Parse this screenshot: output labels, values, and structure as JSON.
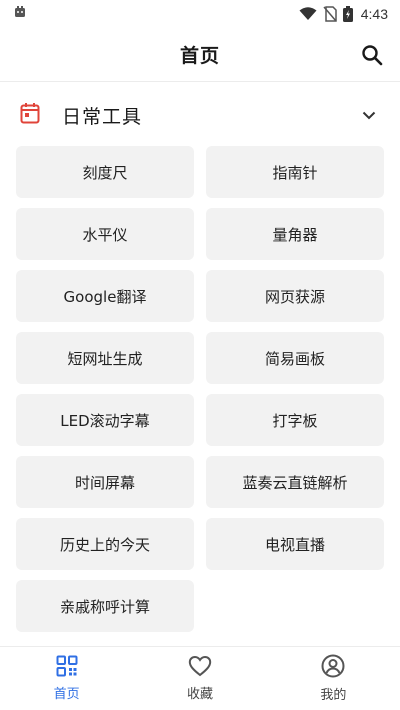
{
  "status_bar": {
    "time": "4:43"
  },
  "header": {
    "title": "首页"
  },
  "section": {
    "title": "日常工具"
  },
  "tools": [
    "刻度尺",
    "指南针",
    "水平仪",
    "量角器",
    "Google翻译",
    "网页获源",
    "短网址生成",
    "简易画板",
    "LED滚动字幕",
    "打字板",
    "时间屏幕",
    "蓝奏云直链解析",
    "历史上的今天",
    "电视直播",
    "亲戚称呼计算"
  ],
  "bottom_nav": [
    {
      "label": "首页",
      "icon": "grid-icon",
      "active": true
    },
    {
      "label": "收藏",
      "icon": "heart-icon",
      "active": false
    },
    {
      "label": "我的",
      "icon": "user-circle-icon",
      "active": false
    }
  ],
  "colors": {
    "accent": "#2f6fe4",
    "section_icon": "#e0443a",
    "tile_bg": "#f2f2f2"
  }
}
